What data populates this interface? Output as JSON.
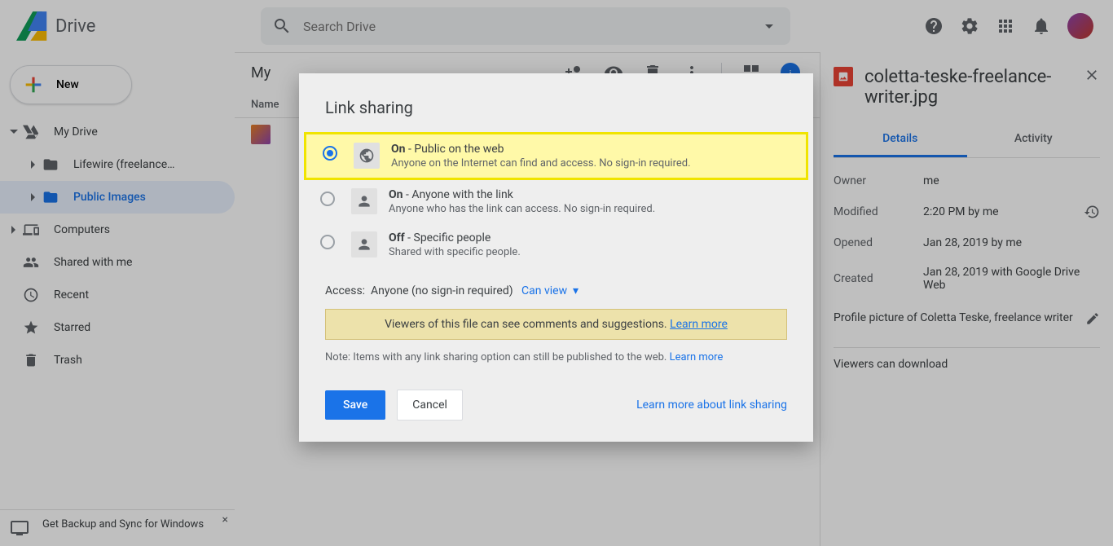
{
  "header": {
    "app_name": "Drive",
    "search_placeholder": "Search Drive"
  },
  "sidebar": {
    "new_label": "New",
    "items": [
      {
        "label": "My Drive"
      },
      {
        "label": "Lifewire (freelance…"
      },
      {
        "label": "Public Images"
      },
      {
        "label": "Computers"
      },
      {
        "label": "Shared with me"
      },
      {
        "label": "Recent"
      },
      {
        "label": "Starred"
      },
      {
        "label": "Trash"
      }
    ],
    "footer": "Get Backup and Sync for Windows"
  },
  "main": {
    "breadcrumb": "My",
    "column_name": "Name"
  },
  "details": {
    "filename": "coletta-teske-freelance-writer.jpg",
    "tabs": {
      "details": "Details",
      "activity": "Activity"
    },
    "meta": [
      {
        "label": "Owner",
        "value": "me"
      },
      {
        "label": "Modified",
        "value": "2:20 PM by me"
      },
      {
        "label": "Opened",
        "value": "Jan 28, 2019 by me"
      },
      {
        "label": "Created",
        "value": "Jan 28, 2019 with Google Drive Web"
      }
    ],
    "description": "Profile picture of Coletta Teske, freelance writer",
    "viewers_can": "Viewers can download"
  },
  "modal": {
    "title": "Link sharing",
    "options": [
      {
        "state": "On",
        "suffix": " - Public on the web",
        "sub": "Anyone on the Internet can find and access. No sign-in required."
      },
      {
        "state": "On",
        "suffix": " - Anyone with the link",
        "sub": "Anyone who has the link can access. No sign-in required."
      },
      {
        "state": "Off",
        "suffix": " - Specific people",
        "sub": "Shared with specific people."
      }
    ],
    "access_label": "Access:",
    "access_value": "Anyone (no sign-in required)",
    "access_perm": "Can view",
    "warn_text": "Viewers of this file can see comments and suggestions. ",
    "warn_link": "Learn more",
    "note_text": "Note: Items with any link sharing option can still be published to the web. ",
    "note_link": "Learn more",
    "save": "Save",
    "cancel": "Cancel",
    "learn_more": "Learn more about link sharing"
  }
}
